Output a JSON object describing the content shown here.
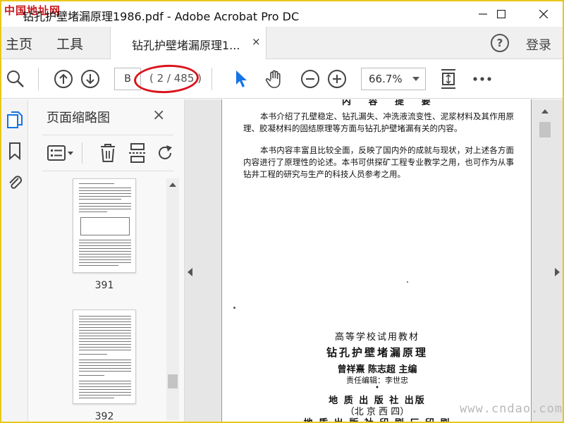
{
  "window": {
    "title": "钻孔护壁堵漏原理1986.pdf - Adobe Acrobat Pro DC",
    "watermark": "中国地址网",
    "corner_watermark": "www.cndao.com"
  },
  "tabs": {
    "home": "主页",
    "tools": "工具",
    "document": "钻孔护壁堵漏原理1...",
    "close": "×",
    "help": "?",
    "login": "登录"
  },
  "toolbar": {
    "page_input": "B",
    "page_count": "( 2 / 485 )",
    "zoom": "66.7%",
    "highlight_color": "#d9141c"
  },
  "panel": {
    "title": "页面缩略图",
    "close": "×",
    "thumbnails": [
      {
        "label": "391"
      },
      {
        "label": "392"
      }
    ]
  },
  "document": {
    "heading": "内 容 提 要",
    "paragraphs": [
      "本书介绍了孔壁稳定、钻孔漏失、冲洗液流变性、泥浆材料及其作用原理、胶凝材料的固结原理等方面与钻孔护壁堵漏有关的内容。",
      "本书内容丰富且比较全面，反映了国内外的成就与现状，对上述各方面内容进行了原理性的论述。本书可供探矿工程专业教学之用，也可作为从事钻井工程的研究与生产的科技人员参考之用。"
    ],
    "credits": {
      "series": "高等学校试用教材",
      "book_title": "钻孔护壁堵漏原理",
      "authors": "曾祥熹  陈志超  主编",
      "editor": "责任编辑：李世忠",
      "bullet": "•",
      "publisher": "地 质 出 版 社 出版",
      "address": "（北 京 西 四）",
      "printer": "地 质 出 版 社 印 刷 厂 印 刷"
    }
  }
}
